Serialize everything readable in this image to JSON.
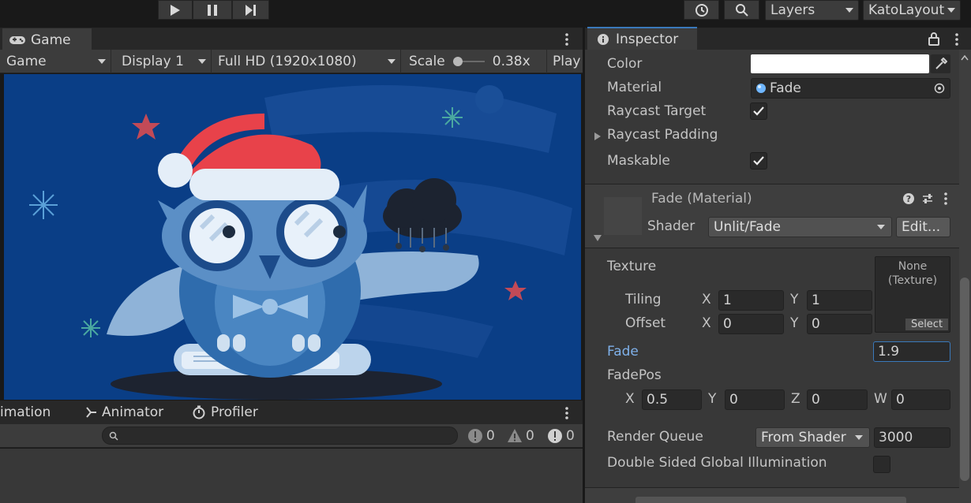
{
  "toolbar": {
    "layers_label": "Layers",
    "layout_label": "KatoLayout"
  },
  "game": {
    "tab_label": "Game",
    "mode": "Game",
    "display": "Display 1",
    "resolution": "Full HD (1920x1080)",
    "scale_label": "Scale",
    "scale_value": "0.38x",
    "play_label": "Play"
  },
  "bottom": {
    "tabs": [
      "imation",
      "Animator",
      "Profiler"
    ],
    "counts": {
      "log": "0",
      "warn": "0",
      "error": "0"
    }
  },
  "inspector": {
    "tab_label": "Inspector",
    "color_label": "Color",
    "material_label": "Material",
    "material_value": "Fade",
    "raycast_target_label": "Raycast Target",
    "raycast_padding_label": "Raycast Padding",
    "maskable_label": "Maskable",
    "mat_title": "Fade (Material)",
    "shader_label": "Shader",
    "shader_value": "Unlit/Fade",
    "edit_label": "Edit...",
    "texture_label": "Texture",
    "texture_slot": "None\n(Texture)",
    "select_label": "Select",
    "tiling_label": "Tiling",
    "offset_label": "Offset",
    "tiling_x": "1",
    "tiling_y": "1",
    "offset_x": "0",
    "offset_y": "0",
    "x": "X",
    "y": "Y",
    "z": "Z",
    "w": "W",
    "fade_label": "Fade",
    "fade_value": "1.9",
    "fadepos_label": "FadePos",
    "fadepos_x": "0.5",
    "fadepos_y": "0",
    "fadepos_z": "0",
    "fadepos_w": "0",
    "render_queue_label": "Render Queue",
    "render_queue_mode": "From Shader",
    "render_queue_value": "3000",
    "dsgi_label": "Double Sided Global Illumination"
  },
  "colors": {
    "accent": "#3a79bb",
    "panel": "#383838",
    "sky": "#0a3e86"
  }
}
